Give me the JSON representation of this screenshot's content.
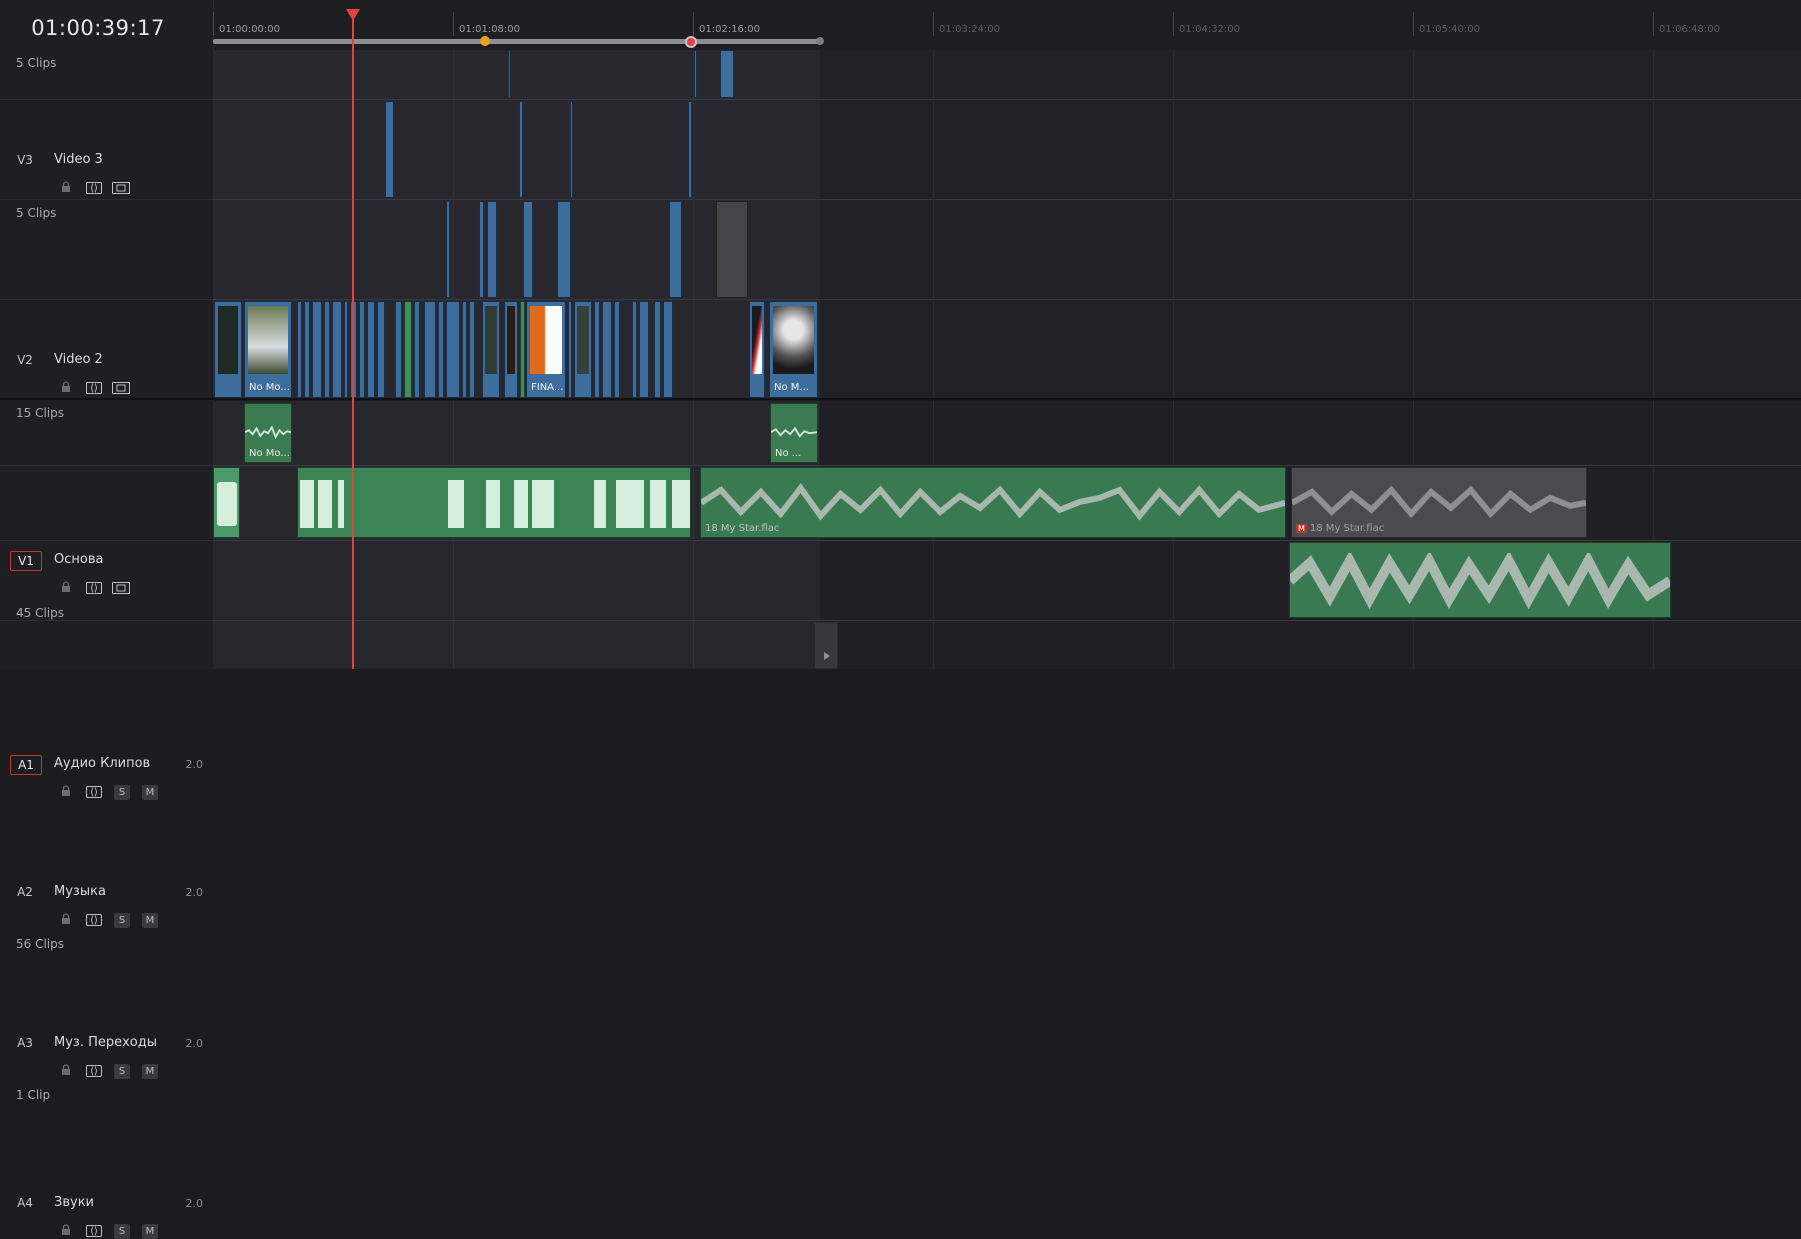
{
  "timecode": "01:00:39:17",
  "ruler": {
    "labels": [
      "01:00:00:00",
      "01:01:08:00",
      "01:02:16:00",
      "01:03:24:00",
      "01:04:32:00",
      "01:05:40:00",
      "01:06:48:00"
    ]
  },
  "video_tracks": [
    {
      "id": "",
      "name": "",
      "count": "5 Clips"
    },
    {
      "id": "V3",
      "name": "Video 3",
      "count": "5 Clips"
    },
    {
      "id": "V2",
      "name": "Video 2",
      "count": "15 Clips"
    },
    {
      "id": "V1",
      "name": "Основа",
      "count": "45 Clips"
    }
  ],
  "audio_tracks": [
    {
      "id": "A1",
      "name": "Аудио Клипов",
      "level": "2.0",
      "count": ""
    },
    {
      "id": "A2",
      "name": "Музыка",
      "level": "2.0",
      "count": "56 Clips"
    },
    {
      "id": "A3",
      "name": "Муз. Переходы",
      "level": "2.0",
      "count": "1 Clip"
    },
    {
      "id": "A4",
      "name": "Звуки",
      "level": "2.0",
      "count": ""
    }
  ],
  "track_buttons": {
    "solo": "S",
    "mute": "M"
  },
  "clip_labels": {
    "v1_clip_a": "No Mo...",
    "v1_clip_b": "FINA...",
    "v1_clip_c": "No M...",
    "a1_clip_a": "No Mo...",
    "a1_clip_b": "No ...",
    "a2_music": "18 My Star.flac",
    "a2_music_muted": "18 My Star.flac",
    "a2_music_muted_badge": "M"
  },
  "colors": {
    "playhead": "#e0443a",
    "video_clip": "#3d6d9c",
    "audio_clip": "#3c7a52",
    "selected_track_outline": "#c0392b",
    "marker_orange": "#e8a020"
  },
  "icons": [
    "lock-icon",
    "auto-select-icon",
    "film-icon",
    "solo-button",
    "mute-button"
  ]
}
